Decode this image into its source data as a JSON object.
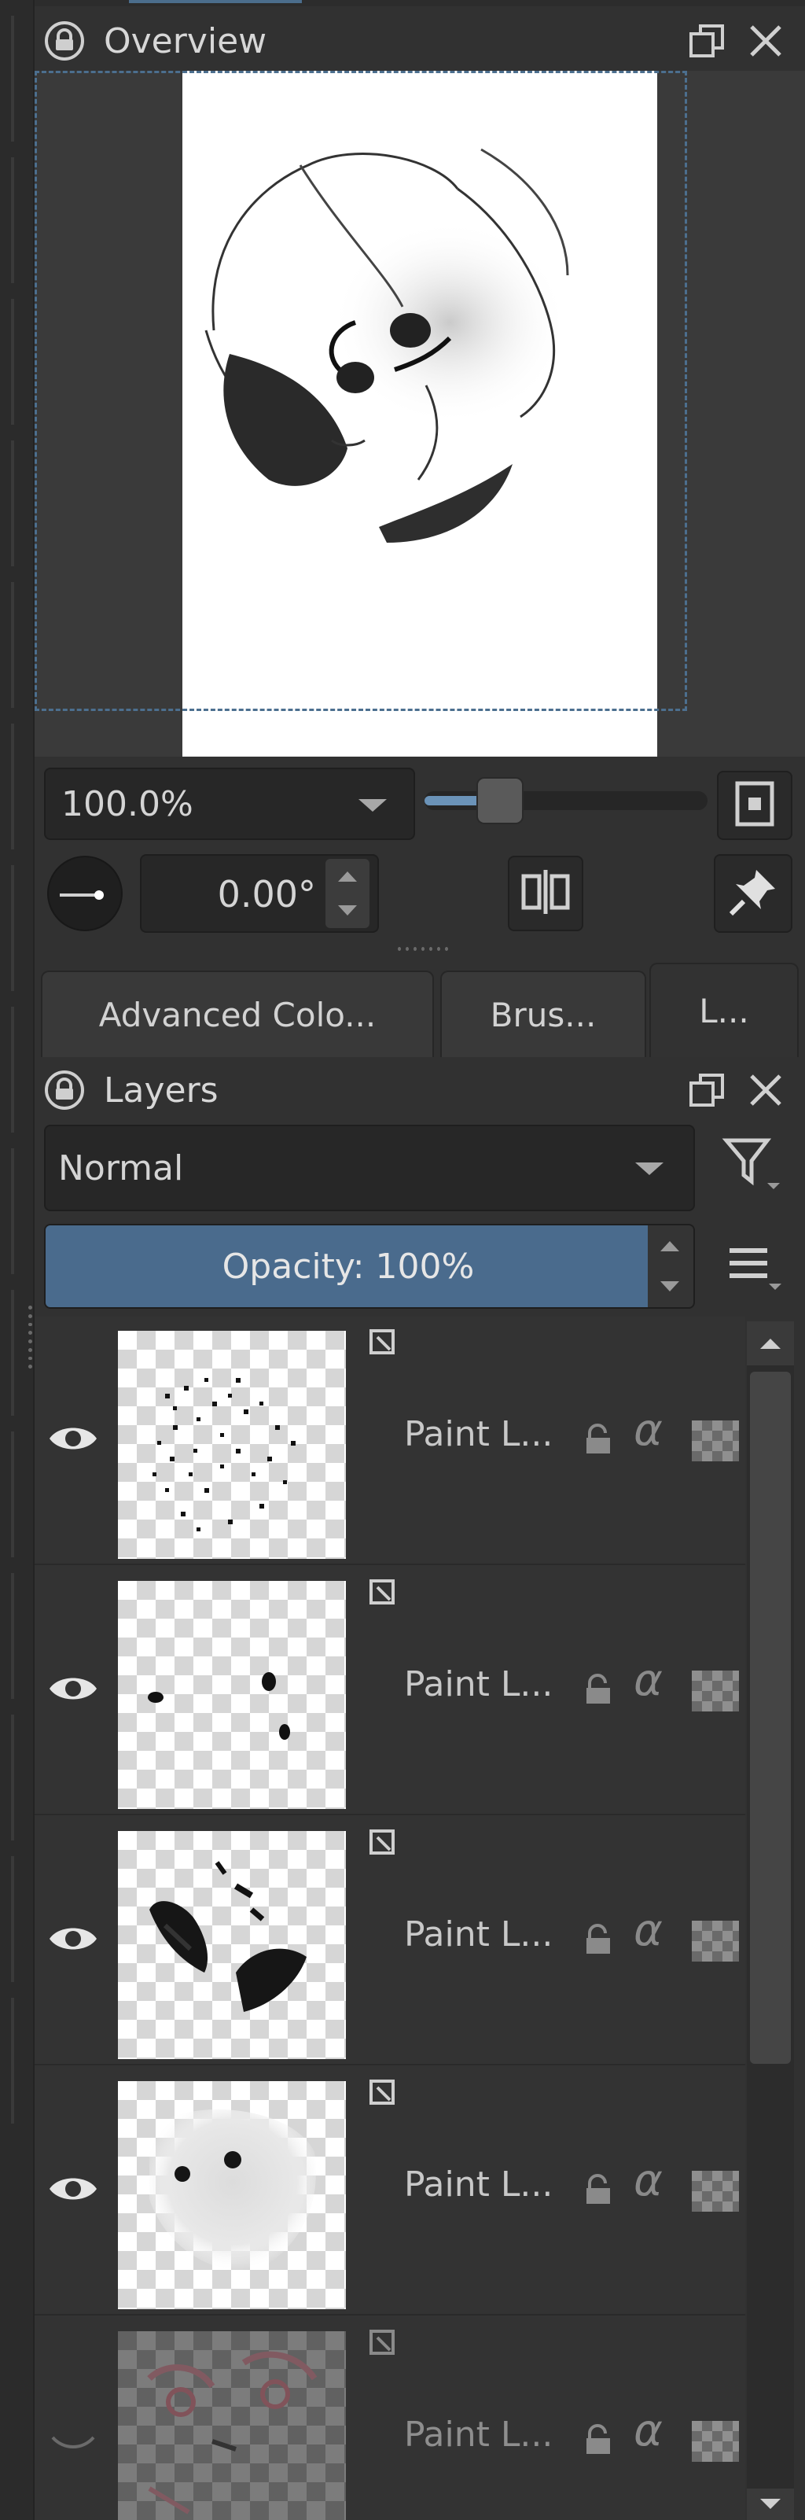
{
  "overview": {
    "title": "Overview",
    "zoom_value": "100.0%",
    "zoom_fraction": 0.22,
    "rotation_value": "0.00°"
  },
  "dock_tabs": [
    {
      "label": "Advanced Colo..."
    },
    {
      "label": "Brus..."
    },
    {
      "label": "L..."
    }
  ],
  "layers": {
    "title": "Layers",
    "blend_mode": "Normal",
    "opacity_label": "Opacity:  100%",
    "opacity_fraction": 1.0,
    "items": [
      {
        "name": "Paint L...",
        "visible": true
      },
      {
        "name": "Paint L...",
        "visible": true
      },
      {
        "name": "Paint L...",
        "visible": true
      },
      {
        "name": "Paint L...",
        "visible": true
      },
      {
        "name": "Paint L...",
        "visible": false
      }
    ]
  },
  "icons": {
    "lock": "lock-icon",
    "float": "float-window-icon",
    "close": "close-icon",
    "fit": "fit-to-view-icon",
    "mirror": "mirror-icon",
    "pin": "pin-icon",
    "filter": "filter-icon",
    "menu": "hamburger-menu-icon",
    "eye": "eye-icon",
    "alpha": "alpha-lock-icon",
    "inherit_alpha": "inherit-alpha-icon"
  },
  "colors": {
    "accent": "#4a6b8d",
    "background": "#313131",
    "panel": "#3a3a3a"
  }
}
